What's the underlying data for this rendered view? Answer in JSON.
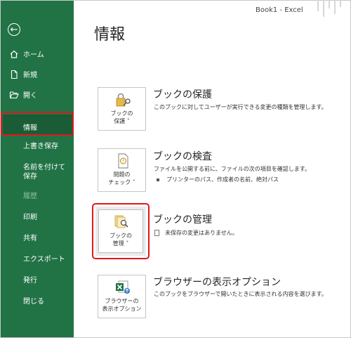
{
  "window": {
    "title": "Book1  -  Excel"
  },
  "page_title": "情報",
  "nav": {
    "back_symbol": "←",
    "top": [
      {
        "label": "ホーム",
        "icon": "home-icon"
      },
      {
        "label": "新規",
        "icon": "new-document-icon"
      },
      {
        "label": "開く",
        "icon": "open-folder-icon"
      }
    ],
    "selected": "情報",
    "items": [
      {
        "label": "上書き保存",
        "enabled": true
      },
      {
        "label": "名前を付けて保存",
        "enabled": true
      },
      {
        "label": "履歴",
        "enabled": false
      },
      {
        "label": "印刷",
        "enabled": true
      },
      {
        "label": "共有",
        "enabled": true
      },
      {
        "label": "エクスポート",
        "enabled": true
      },
      {
        "label": "発行",
        "enabled": true
      },
      {
        "label": "閉じる",
        "enabled": true
      }
    ]
  },
  "sections": [
    {
      "button": "ブックの\n保護 ˅",
      "title": "ブックの保護",
      "desc": "このブックに対してユーザーが実行できる変更の種類を管理します。",
      "icon": "lock-key-icon"
    },
    {
      "button": "問題の\nチェック ˅",
      "title": "ブックの検査",
      "desc": "ファイルを公開する前に、ファイルの次の項目を確認します。",
      "bullet": "プリンターのパス、作成者の名前、絶対パス",
      "icon": "inspect-document-icon"
    },
    {
      "button": "ブックの\n管理 ˅",
      "title": "ブックの管理",
      "desc": "未保存の変更はありません。",
      "icon": "manage-workbook-icon"
    },
    {
      "button": "ブラウザーの\n表示オプション",
      "title": "ブラウザーの表示オプション",
      "desc": "このブックをブラウザーで開いたときに表示される内容を選びます。",
      "icon": "excel-browser-icon"
    }
  ],
  "colors": {
    "sidebar": "#217346",
    "highlight": "#e4161c"
  }
}
